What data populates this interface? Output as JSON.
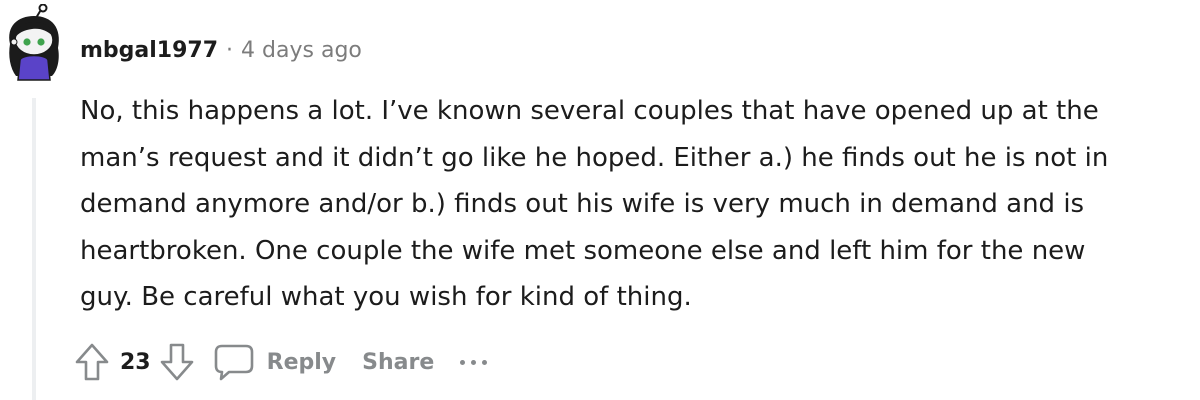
{
  "comment": {
    "username": "mbgal1977",
    "separator": "·",
    "timestamp": "4 days ago",
    "avatar_icon": "snoo-avatar-icon",
    "body_lines": [
      "No, this happens a lot. I’ve known several couples that have opened up at the",
      "man’s request and it didn’t go like he hoped. Either a.) he finds out he is not in",
      "demand anymore and/or b.) finds out his wife is very much in demand and is",
      "heartbroken. One couple the wife met someone else and left him for the new",
      "guy. Be careful what you wish for kind of thing."
    ]
  },
  "actions": {
    "upvote_icon": "upvote-arrow-icon",
    "vote_count": "23",
    "downvote_icon": "downvote-arrow-icon",
    "reply_icon": "speech-bubble-icon",
    "reply_label": "Reply",
    "share_label": "Share",
    "more_icon": "ellipsis-icon"
  },
  "colors": {
    "text": "#1c1c1c",
    "muted": "#7c7c7c",
    "action_gray": "#878a8c",
    "thread_line": "#edeff1"
  }
}
